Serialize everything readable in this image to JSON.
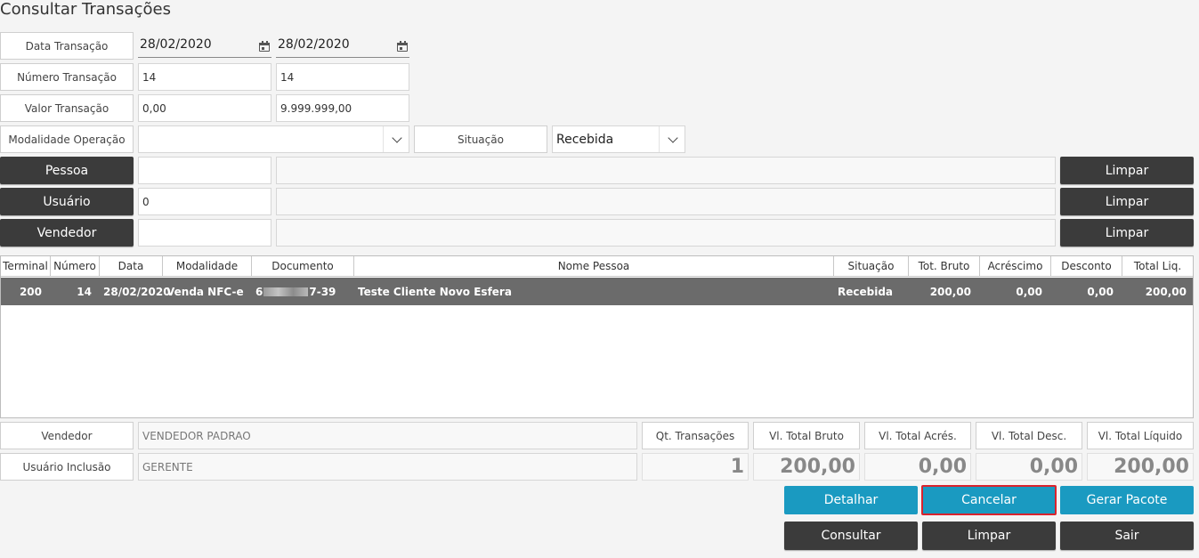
{
  "page": {
    "title": "Consultar Transações"
  },
  "filters": {
    "data_transacao": {
      "label": "Data Transação",
      "from": "28/02/2020",
      "to": "28/02/2020"
    },
    "numero_transacao": {
      "label": "Número Transação",
      "from": "14",
      "to": "14"
    },
    "valor_transacao": {
      "label": "Valor Transação",
      "from": "0,00",
      "to": "9.999.999,00"
    },
    "modalidade_operacao": {
      "label": "Modalidade Operação",
      "value": ""
    },
    "situacao": {
      "label": "Situação",
      "value": "Recebida"
    },
    "pessoa": {
      "label": "Pessoa",
      "code": "",
      "name": "",
      "clear": "Limpar"
    },
    "usuario": {
      "label": "Usuário",
      "code": "0",
      "name": "",
      "clear": "Limpar"
    },
    "vendedor": {
      "label": "Vendedor",
      "code": "",
      "name": "",
      "clear": "Limpar"
    }
  },
  "grid": {
    "columns": [
      "Terminal",
      "Número",
      "Data",
      "Modalidade",
      "Documento",
      "Nome Pessoa",
      "Situação",
      "Tot. Bruto",
      "Acréscimo",
      "Desconto",
      "Total Liq."
    ],
    "rows": [
      {
        "terminal": "200",
        "numero": "14",
        "data": "28/02/2020",
        "modalidade": "Venda NFC-e",
        "documento_prefix": "6",
        "documento_suffix": "7-39",
        "nome_pessoa": "Teste Cliente Novo Esfera",
        "situacao": "Recebida",
        "tot_bruto": "200,00",
        "acrescimo": "0,00",
        "desconto": "0,00",
        "total_liq": "200,00"
      }
    ]
  },
  "details": {
    "vendedor": {
      "label": "Vendedor",
      "value": "VENDEDOR PADRAO"
    },
    "usuario_inclusao": {
      "label": "Usuário Inclusão",
      "value": "GERENTE"
    }
  },
  "totals": {
    "qt_transacoes": {
      "label": "Qt. Transações",
      "value": "1"
    },
    "vl_total_bruto": {
      "label": "Vl. Total Bruto",
      "value": "200,00"
    },
    "vl_total_acres": {
      "label": "Vl. Total Acrés.",
      "value": "0,00"
    },
    "vl_total_desc": {
      "label": "Vl. Total Desc.",
      "value": "0,00"
    },
    "vl_total_liquido": {
      "label": "Vl. Total Líquido",
      "value": "200,00"
    }
  },
  "actions": {
    "detalhar": "Detalhar",
    "cancelar": "Cancelar",
    "gerar_pacote": "Gerar Pacote",
    "consultar": "Consultar",
    "limpar": "Limpar",
    "sair": "Sair"
  },
  "colors": {
    "blue_button": "#1a9ac1",
    "dark_button": "#3b3b3b",
    "selected_row": "#6b6b6b",
    "highlight_border": "#d9232d"
  },
  "icons": {
    "date_picker": "calendar-icon",
    "dropdown": "chevron-down-icon"
  }
}
